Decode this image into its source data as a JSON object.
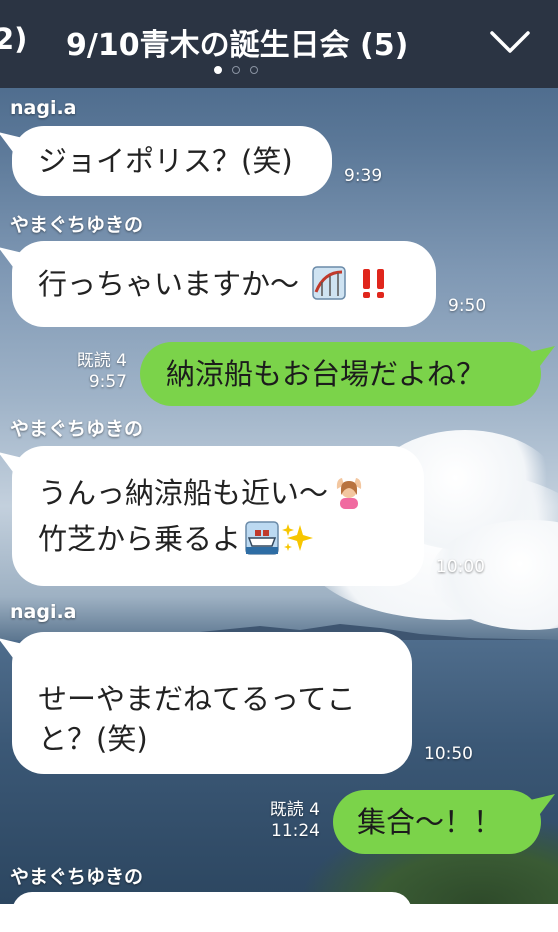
{
  "header": {
    "back_count": "2)",
    "title": "9/10青木の誕生日会 (5)"
  },
  "messages": [
    {
      "sender": "nagi.a",
      "lines": [
        "ジョイポリス？(笑)"
      ],
      "time": "9:39"
    },
    {
      "sender": "やまぐちゆきの",
      "lines": [
        "行っちゃいますか〜"
      ],
      "time": "9:50"
    },
    {
      "direction": "outgoing",
      "read": "既読 4",
      "time": "9:57",
      "lines": [
        "納涼船もお台場だよね？"
      ]
    },
    {
      "sender": "やまぐちゆきの",
      "lines": [
        "うんっ納涼船も近い〜",
        "竹芝から乗るよ"
      ],
      "time": "10:00"
    },
    {
      "sender": "nagi.a",
      "lines": [
        "せーやまだねてるってこ",
        "と？(笑)"
      ],
      "time": "10:50"
    },
    {
      "direction": "outgoing",
      "read": "既読 4",
      "time": "11:24",
      "lines": [
        "集合〜！！"
      ]
    },
    {
      "sender": "やまぐちゆきの",
      "lines": []
    }
  ],
  "colors": {
    "header_bg": "#2b3443",
    "outgoing_bubble": "#7bd34a",
    "incoming_bubble": "#ffffff"
  },
  "icons": [
    "chevron-down-icon",
    "roller-coaster-icon",
    "double-exclamation-icon",
    "woman-ok-gesture-icon",
    "ship-icon",
    "sparkles-icon"
  ]
}
